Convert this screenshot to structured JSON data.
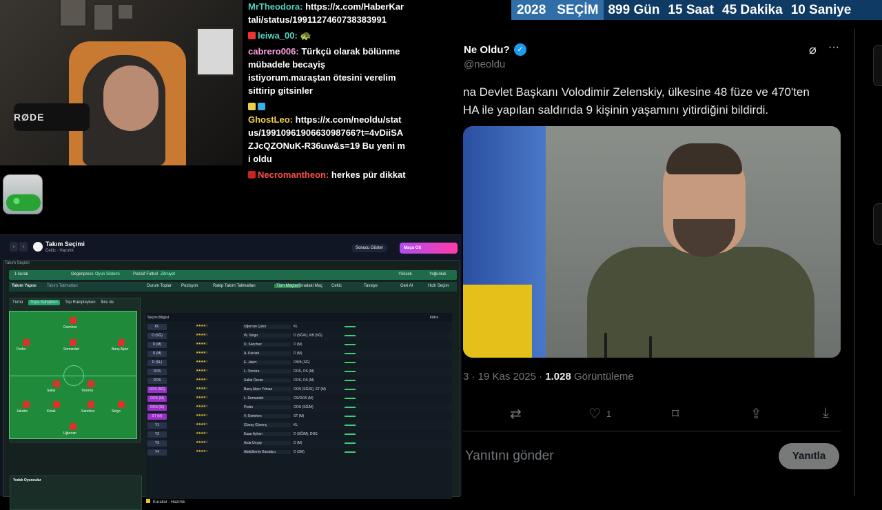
{
  "banner": {
    "year": "2028",
    "label": "SEÇİM",
    "days": "899 Gün",
    "hours": "15 Saat",
    "minutes": "45 Dakika",
    "seconds": "10 Saniye"
  },
  "webcam": {
    "mic_brand": "RØDE"
  },
  "chat": [
    {
      "user": "MrTheodora",
      "text": "https://x.com/HaberKartali/status/1991127460738383991",
      "color": "#4fd3c4"
    },
    {
      "user": "leiwa_00",
      "text": "🐢",
      "color": "#4fd3c4"
    },
    {
      "user": "cabrero006",
      "text": "Türkçü olarak bölünme mübadele becayiş istiyorum.maraştan ötesini verelim sittirip gitsinler",
      "color": "#ff9de0"
    },
    {
      "user": "GhostLeo",
      "text": "https://x.com/neoldu/status/1991096190663098766?t=4vDiiSAZJcQZONuK-R36uw&s=19 Bu yeni mi oldu",
      "color": "#f2d24a"
    },
    {
      "user": "Necromantheon",
      "text": "herkes pür dikkat",
      "color": "#ff4f4f"
    }
  ],
  "game": {
    "title": "Takım Seçimi",
    "subtitle_club": "Celtic",
    "subtitle_status": "Hazırlık",
    "results_button": "Sonucu Göster",
    "continue_button": "Maça Git",
    "panel_title": "Takım Seçimi",
    "toolbar1": [
      "1 kurak",
      "Gegenpress",
      "Oyun Sistemi",
      "Pozisif Futbol",
      "Zihniyet",
      "Yüksek",
      "Yoğunluk"
    ],
    "toolbar2": [
      "Takım Yapısı",
      "Takım Talimatları",
      "Durum Toplar",
      "Pozisyon",
      "Rakip Takım Talimatları",
      "Tüm Maçlar",
      "Sıradaki Maç",
      "Celtic",
      "Tavsiye",
      "Geri Al",
      "Hızlı Seçim"
    ],
    "pitch_tabs": [
      "Tümü",
      "Topa Sahipken",
      "Top Rakipteyken",
      "İkisi de"
    ],
    "players_pitch": [
      {
        "name": "Osimhen"
      },
      {
        "name": "Pedro"
      },
      {
        "name": "Somandet"
      },
      {
        "name": "Barış Alper"
      },
      {
        "name": "Sallai"
      },
      {
        "name": "Torreira"
      },
      {
        "name": "Jakobs"
      },
      {
        "name": "Kiriak"
      },
      {
        "name": "Sanchez"
      },
      {
        "name": "Singo"
      },
      {
        "name": "Uğurcan"
      }
    ],
    "selection_info": "Seçim Bilgisi",
    "filter": "Filtre",
    "table_rows": [
      {
        "pos": "KL",
        "name": "Uğurcan Çakır",
        "role": "KL",
        "p": "g"
      },
      {
        "pos": "D (SĞ)",
        "name": "W. Singo",
        "role": "D (SĞ/K), KB (SĞ)",
        "p": "g"
      },
      {
        "pos": "D (M)",
        "name": "D. Sánchez",
        "role": "D (M)",
        "p": "g"
      },
      {
        "pos": "D (M)",
        "name": "A. Kürüah",
        "role": "D (M)",
        "p": "g"
      },
      {
        "pos": "D (SL)",
        "name": "E. Jakırt",
        "role": "D/KB (SĞ)",
        "p": "g"
      },
      {
        "pos": "DOS",
        "name": "L. Torreira",
        "role": "DOS, OS (M)",
        "p": "g"
      },
      {
        "pos": "DOS",
        "name": "Sallai Özcan",
        "role": "DOS, OS (M)",
        "p": "g"
      },
      {
        "pos": "OOS (SĞ)",
        "name": "Barış Alper Yılmaz",
        "role": "OOS (SĞ/Sl), ST (M)",
        "p": "p"
      },
      {
        "pos": "OOS (M)",
        "name": "L. Somandet",
        "role": "OS/OOS (M)",
        "p": "p"
      },
      {
        "pos": "OOS (Sl)",
        "name": "Pedro",
        "role": "OOS (SĞ/M)",
        "p": "p"
      },
      {
        "pos": "ST (M)",
        "name": "V. Osimhen",
        "role": "ST (M)",
        "p": "p"
      },
      {
        "pos": "Y1",
        "name": "Günay Güvenç",
        "role": "KL",
        "p": "g"
      },
      {
        "pos": "Y2",
        "name": "Kaan Ayhan",
        "role": "D (SĞ/M), DOS",
        "p": "g"
      },
      {
        "pos": "Y3",
        "name": "Arda Ünyay",
        "role": "D (M)",
        "p": "g"
      },
      {
        "pos": "Y4",
        "name": "Abdülkerim Bardakcı",
        "role": "D (SM)",
        "p": "g"
      }
    ],
    "subs_title": "Yedek Oyuncular",
    "footer": "Kurallar - Hazırlık"
  },
  "tweet": {
    "name": "Ne Oldu?",
    "handle": "@neoldu",
    "text_line1": "na Devlet Başkanı Volodimir Zelenskiy, ülkesine 48 füze ve 470'ten",
    "text_line2": "HA ile yapılan saldırıda 9 kişinin yaşamını yitirdiğini bildirdi.",
    "date": "3 · 19 Kas 2025 · ",
    "views": "1.028",
    "views_label": " Görüntüleme",
    "like_count": "1",
    "reply_placeholder": "Yanıtını gönder",
    "reply_button": "Yanıtla"
  },
  "colors": {
    "banner_bg": "#0f3a63",
    "accent_blue": "#1d9bf0",
    "game_green": "#1e6b4a"
  },
  "icons": [
    "verified-icon",
    "grok-icon",
    "more-icon",
    "retweet-icon",
    "like-icon",
    "bookmark-icon",
    "share-icon",
    "download-icon"
  ]
}
